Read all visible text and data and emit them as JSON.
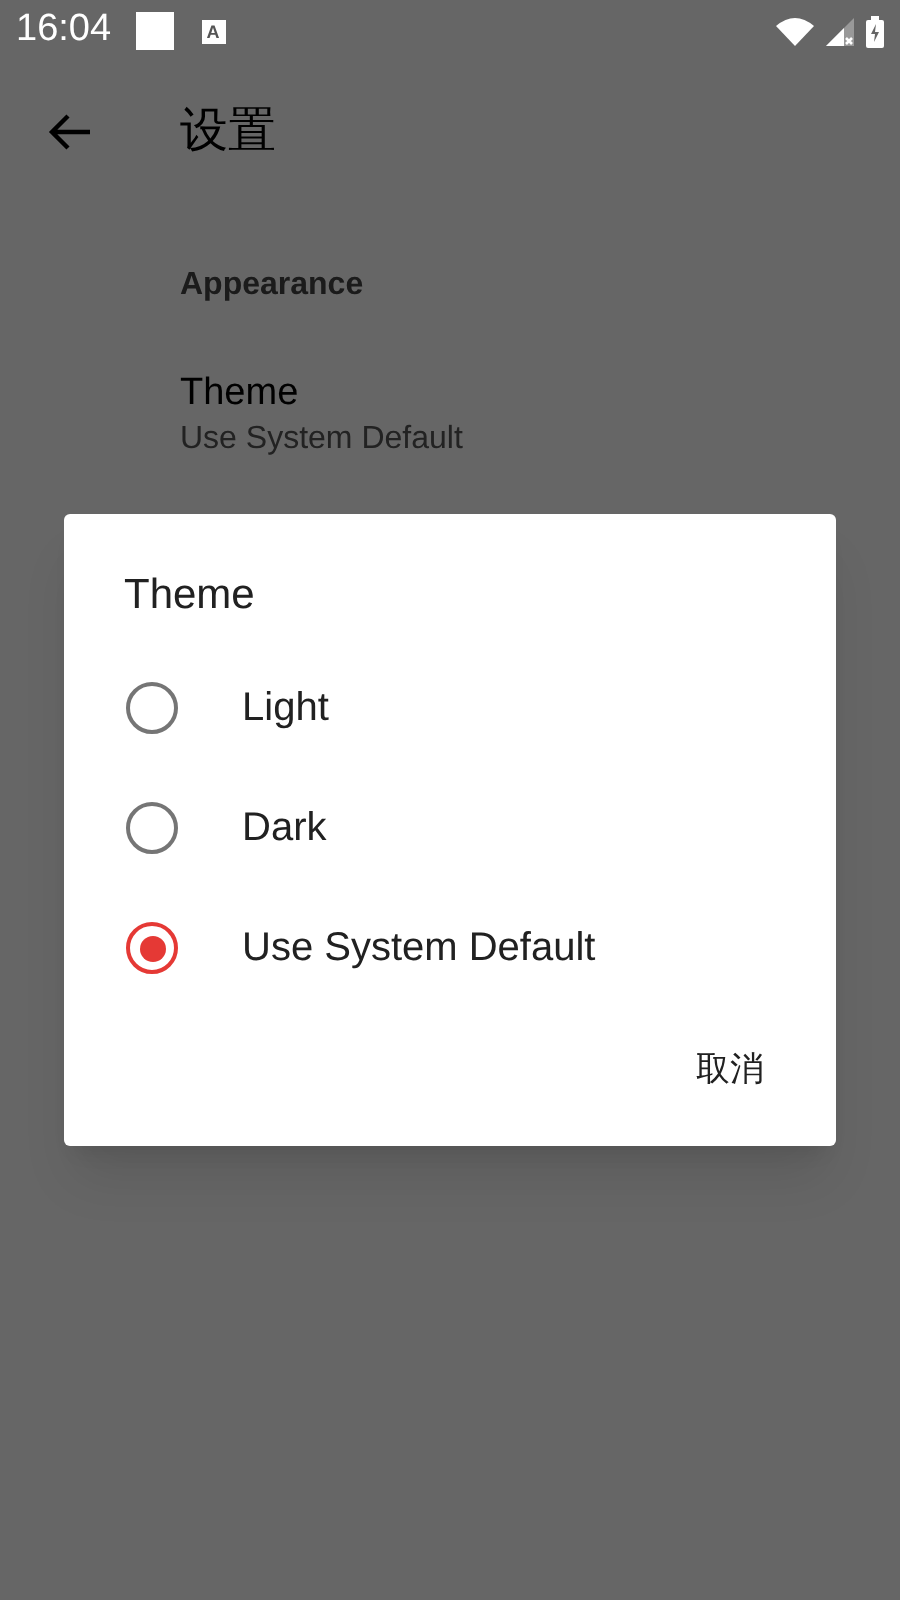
{
  "status_bar": {
    "time": "16:04",
    "notifications": [
      {
        "kind": "square"
      },
      {
        "kind": "letter",
        "text": "A"
      }
    ]
  },
  "app_bar": {
    "title": "设置"
  },
  "settings": {
    "section": "Appearance",
    "items": [
      {
        "title": "Theme",
        "summary": "Use System Default"
      }
    ]
  },
  "dialog": {
    "title": "Theme",
    "options": [
      {
        "label": "Light",
        "selected": false
      },
      {
        "label": "Dark",
        "selected": false
      },
      {
        "label": "Use System Default",
        "selected": true
      }
    ],
    "buttons": [
      "取消"
    ]
  }
}
